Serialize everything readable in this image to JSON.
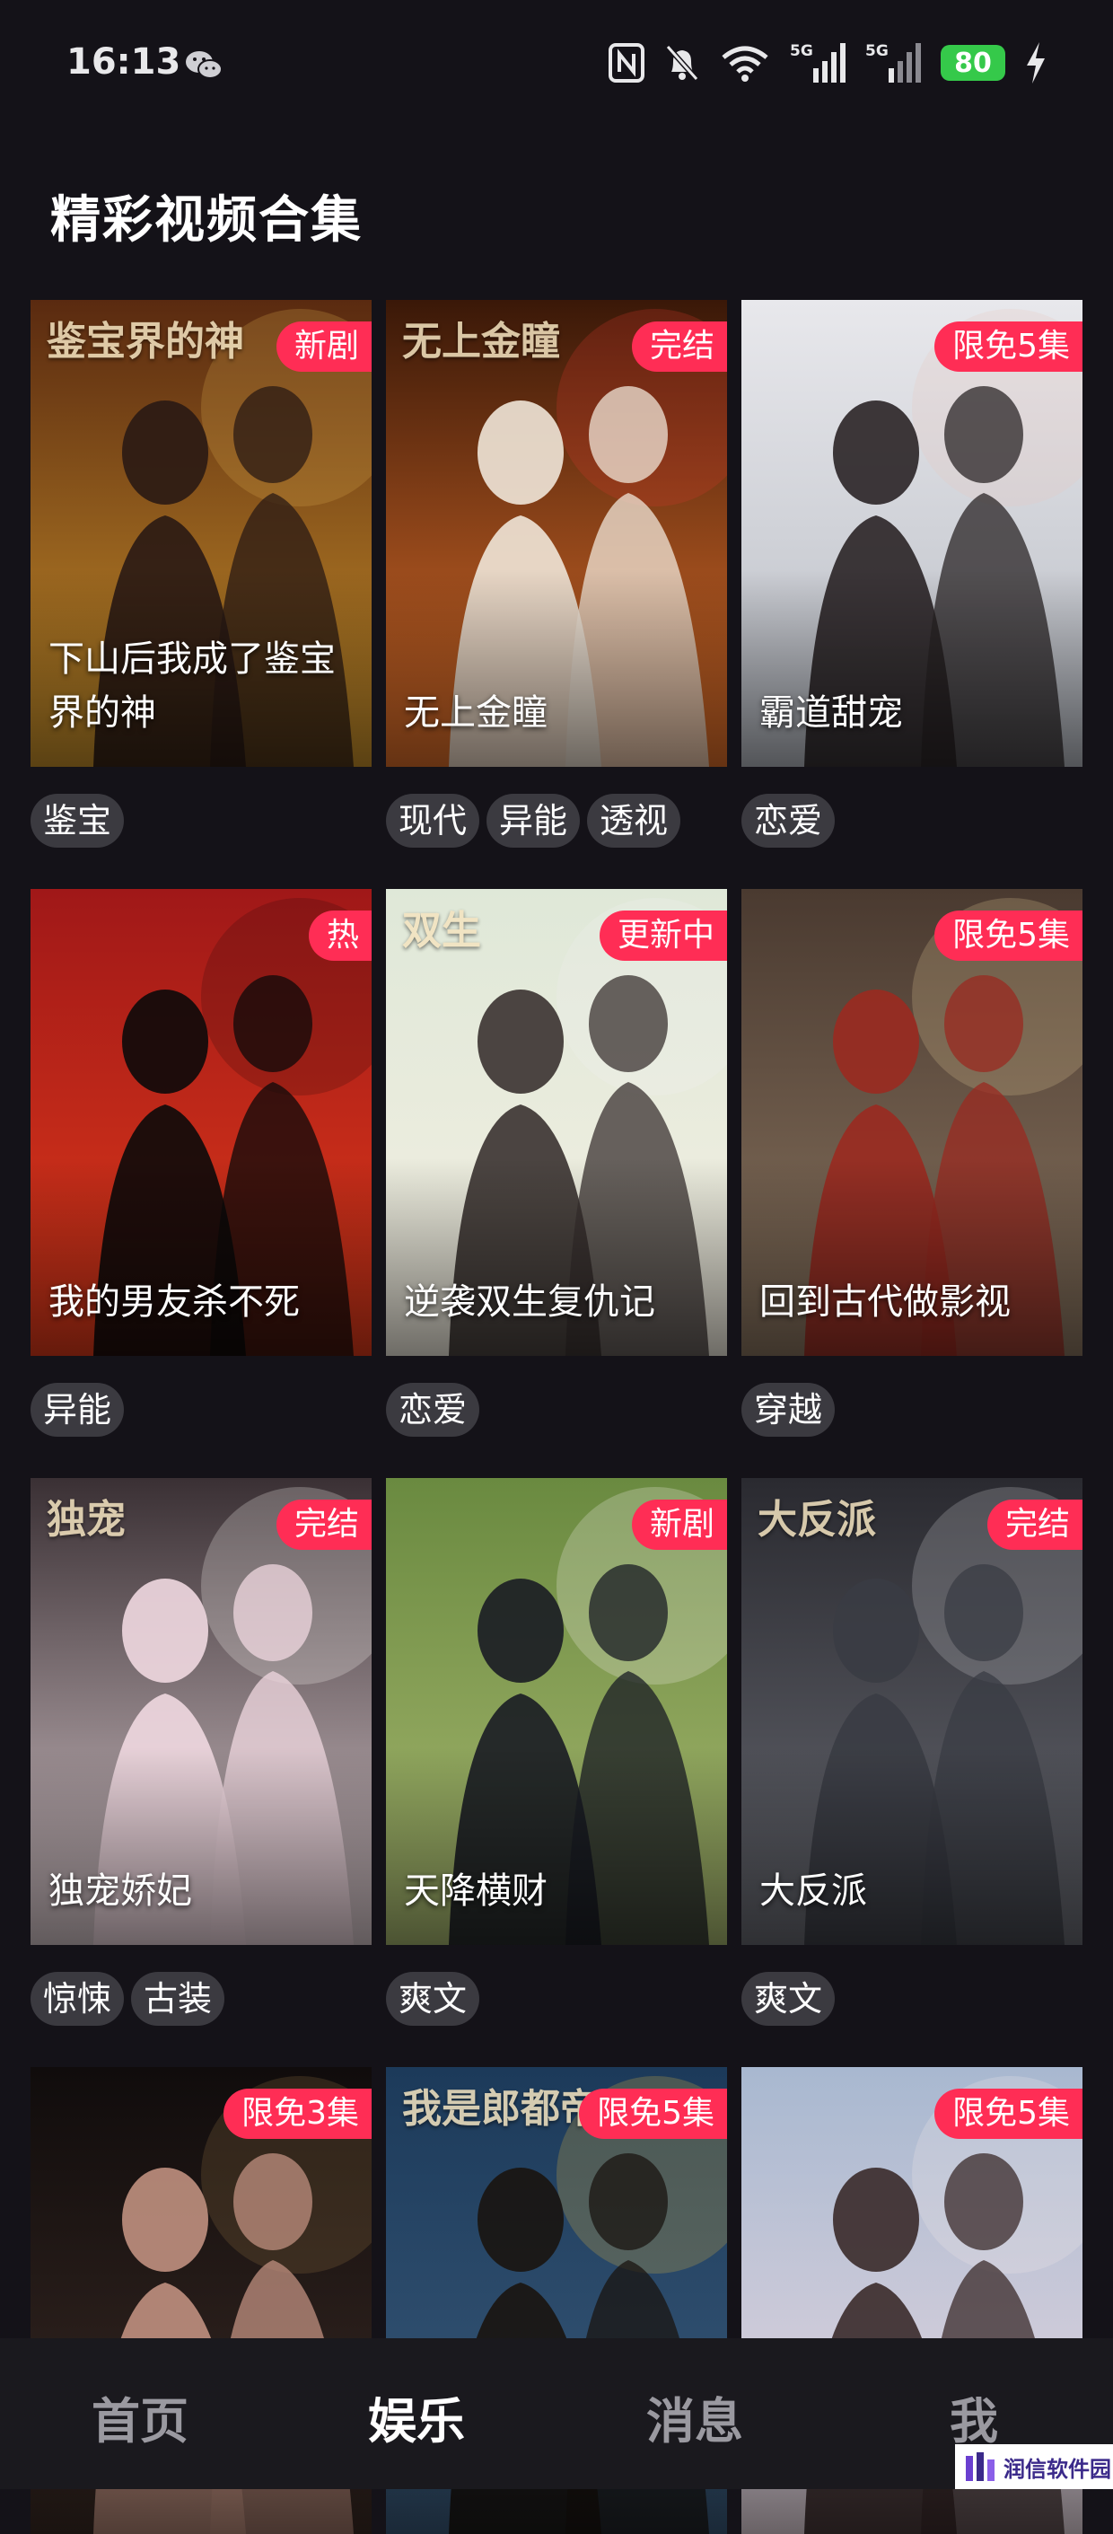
{
  "status": {
    "time": "16:13",
    "battery": "80",
    "signal_1": "5G",
    "signal_2": "5G",
    "icons": [
      "wechat-icon",
      "nfc-icon",
      "mute-bell-icon",
      "wifi-icon",
      "signal-5g-icon",
      "signal-5g-icon",
      "battery-icon",
      "charging-bolt-icon"
    ]
  },
  "page": {
    "title": "精彩视频合集"
  },
  "cards": [
    {
      "title": "下山后我成了鉴宝界的神",
      "badge": "新剧",
      "tags": [
        "鉴宝"
      ],
      "poster_text": "鉴宝界的神"
    },
    {
      "title": "无上金瞳",
      "badge": "完结",
      "tags": [
        "现代",
        "异能",
        "透视"
      ],
      "poster_text": "无上金瞳"
    },
    {
      "title": "霸道甜宠",
      "badge": "限免5集",
      "tags": [
        "恋爱"
      ]
    },
    {
      "title": "我的男友杀不死",
      "badge": "热",
      "tags": [
        "异能"
      ]
    },
    {
      "title": "逆袭双生复仇记",
      "badge": "更新中",
      "tags": [
        "恋爱"
      ],
      "poster_text": "双生"
    },
    {
      "title": "回到古代做影视",
      "badge": "限免5集",
      "tags": [
        "穿越"
      ]
    },
    {
      "title": "独宠娇妃",
      "badge": "完结",
      "tags": [
        "惊悚",
        "古装"
      ],
      "poster_text": "独宠"
    },
    {
      "title": "天降横财",
      "badge": "新剧",
      "tags": [
        "爽文"
      ]
    },
    {
      "title": "大反派",
      "badge": "完结",
      "tags": [
        "爽文"
      ],
      "poster_text": "大反派"
    },
    {
      "title": "",
      "badge": "限免3集",
      "tags": []
    },
    {
      "title": "",
      "badge": "限免5集",
      "tags": [],
      "poster_text": "我是郎都帝"
    },
    {
      "title": "",
      "badge": "限免5集",
      "tags": []
    }
  ],
  "nav": [
    {
      "label": "首页",
      "active": false
    },
    {
      "label": "娱乐",
      "active": true
    },
    {
      "label": "消息",
      "active": false
    },
    {
      "label": "我",
      "active": false
    }
  ],
  "watermark": {
    "text": "润信软件园"
  },
  "colors": {
    "background": "#141218",
    "badge": "#ff2d55",
    "tag": "#3b3a40",
    "battery": "#35c94a"
  }
}
